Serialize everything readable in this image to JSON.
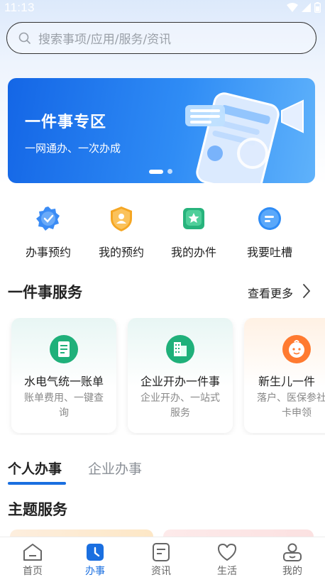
{
  "status_bar": {
    "time": "11:13"
  },
  "search": {
    "placeholder": "搜索事项/应用/服务/资讯"
  },
  "banner": {
    "title": "一件事专区",
    "subtitle": "一网通办、一次办成"
  },
  "quick_actions": [
    {
      "label": "办事预约",
      "icon": "calendar-check-icon"
    },
    {
      "label": "我的预约",
      "icon": "user-shield-icon"
    },
    {
      "label": "我的办件",
      "icon": "star-card-icon"
    },
    {
      "label": "我要吐槽",
      "icon": "chat-bubble-icon"
    }
  ],
  "services": {
    "title": "一件事服务",
    "more_label": "查看更多",
    "cards": [
      {
        "title": "水电气统一账单",
        "desc": "账单费用、一键查询",
        "icon": "bill-icon"
      },
      {
        "title": "企业开办一件事",
        "desc": "企业开办、一站式服务",
        "icon": "building-icon"
      },
      {
        "title": "新生儿一件",
        "desc": "落户、医保参社保卡申领",
        "icon": "baby-icon"
      }
    ]
  },
  "tabs": {
    "personal": "个人办事",
    "company": "企业办事"
  },
  "theme": {
    "title": "主题服务"
  },
  "bottom_nav": [
    {
      "label": "首页",
      "icon": "home-icon"
    },
    {
      "label": "办事",
      "icon": "clock-icon"
    },
    {
      "label": "资讯",
      "icon": "news-icon"
    },
    {
      "label": "生活",
      "icon": "heart-icon"
    },
    {
      "label": "我的",
      "icon": "user-icon"
    }
  ],
  "colors": {
    "accent": "#1a6fe0",
    "banner": "#1466e6"
  }
}
